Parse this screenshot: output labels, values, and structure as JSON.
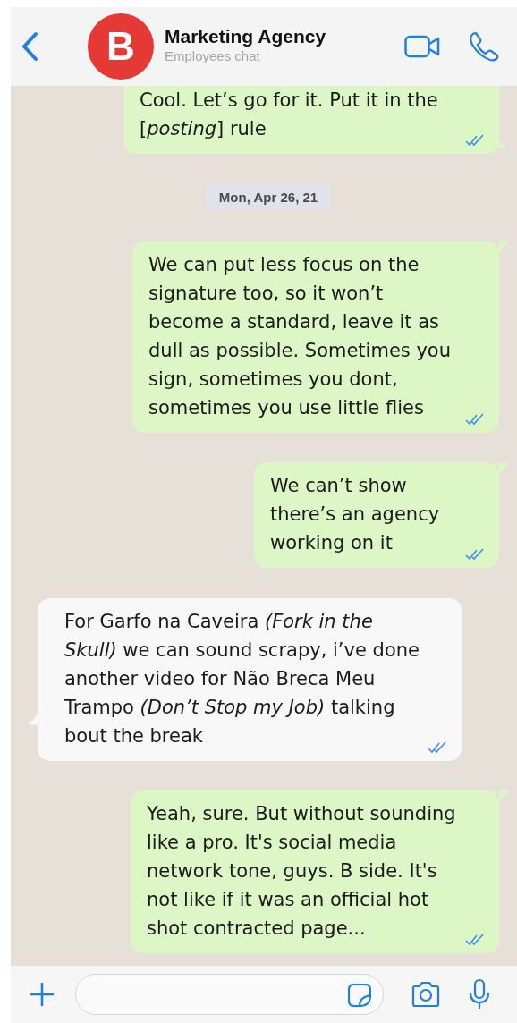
{
  "header": {
    "avatar_letter": "B",
    "title": "Marketing Agency",
    "subtitle": "Employees chat"
  },
  "messages": [
    {
      "kind": "outgoing",
      "text": "Cool. Let’s go for it. Put it in the [*posting*] rule",
      "read": true,
      "cut_top": true
    },
    {
      "kind": "date",
      "text": "Mon, Apr 26, 21"
    },
    {
      "kind": "outgoing",
      "text": "We can put less focus on the signature too, so it won’t become a standard, leave it as dull as possible. Sometimes you sign, sometimes you dont, sometimes you use little flies",
      "read": true
    },
    {
      "kind": "outgoing",
      "text": "We can’t show there’s an agency working on it",
      "read": true
    },
    {
      "kind": "incoming",
      "text": "For Garfo na Caveira *(Fork in the Skull)* we can sound scrapy, i’ve done another video for Não Breca Meu Trampo *(Don’t Stop my Job)* talking bout the break",
      "read": true
    },
    {
      "kind": "outgoing",
      "text": "Yeah, sure. But without sounding like a pro. It's social media network tone, guys. B side. It's not like if it was an official hot shot contracted page...",
      "read": true
    }
  ]
}
